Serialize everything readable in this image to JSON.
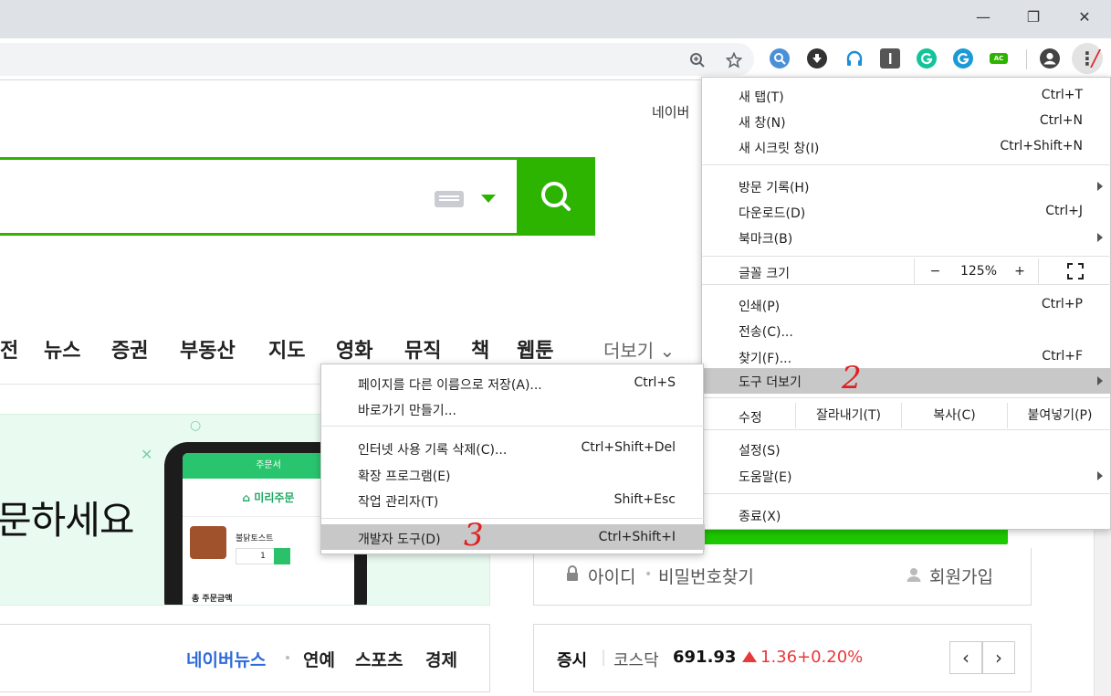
{
  "window": {
    "minimize": "—",
    "maximize": "❐",
    "close": "✕"
  },
  "toolbar": {
    "kebab": "⋮"
  },
  "annotations": {
    "step1": "/",
    "step2": "2",
    "step3": "3"
  },
  "naver": {
    "top_link": "네이버",
    "nav": [
      "전",
      "뉴스",
      "증권",
      "부동산",
      "지도",
      "영화",
      "뮤직",
      "책",
      "웹툰"
    ],
    "nav_more": "더보기 ⌄",
    "banner_text": "문하세요",
    "phone": {
      "header": "주문서",
      "subheader": "⌂ 미리주문",
      "item_name": "불닭토스트",
      "qty": "1",
      "total_label": "총 주문금액"
    },
    "login": {
      "id": "아이디",
      "find_pw": "비밀번호찾기",
      "signup": "회원가입"
    },
    "news": {
      "naver_news": "네이버뉴스",
      "entertainment": "연예",
      "sports": "스포츠",
      "economy": "경제"
    },
    "stock": {
      "label": "증시",
      "index": "코스닥",
      "value": "691.93",
      "change": "1.36",
      "percent": "+0.20%",
      "prev": "‹",
      "next": "›"
    }
  },
  "menu": {
    "new_tab": {
      "label": "새 탭(T)",
      "shortcut": "Ctrl+T"
    },
    "new_window": {
      "label": "새 창(N)",
      "shortcut": "Ctrl+N"
    },
    "incognito": {
      "label": "새 시크릿 창(I)",
      "shortcut": "Ctrl+Shift+N"
    },
    "history": {
      "label": "방문 기록(H)"
    },
    "downloads": {
      "label": "다운로드(D)",
      "shortcut": "Ctrl+J"
    },
    "bookmarks": {
      "label": "북마크(B)"
    },
    "zoom": {
      "label": "글꼴 크기",
      "minus": "−",
      "value": "125%",
      "plus": "+",
      "fullscreen": "⛶"
    },
    "print": {
      "label": "인쇄(P)",
      "shortcut": "Ctrl+P"
    },
    "cast": {
      "label": "전송(C)..."
    },
    "find": {
      "label": "찾기(F)...",
      "shortcut": "Ctrl+F"
    },
    "more_tools": {
      "label": "도구 더보기"
    },
    "edit": {
      "label": "수정",
      "cut": "잘라내기(T)",
      "copy": "복사(C)",
      "paste": "붙여넣기(P)"
    },
    "settings": {
      "label": "설정(S)"
    },
    "help": {
      "label": "도움말(E)"
    },
    "exit": {
      "label": "종료(X)"
    }
  },
  "submenu": {
    "save_as": {
      "label": "페이지를 다른 이름으로 저장(A)...",
      "shortcut": "Ctrl+S"
    },
    "shortcut": {
      "label": "바로가기 만들기..."
    },
    "clear_data": {
      "label": "인터넷 사용 기록 삭제(C)...",
      "shortcut": "Ctrl+Shift+Del"
    },
    "extensions": {
      "label": "확장 프로그램(E)"
    },
    "task_manager": {
      "label": "작업 관리자(T)",
      "shortcut": "Shift+Esc"
    },
    "devtools": {
      "label": "개발자 도구(D)",
      "shortcut": "Ctrl+Shift+I"
    }
  },
  "colors": {
    "naver_green": "#2db400",
    "highlight": "#c8c8c8",
    "annotation_red": "#e02020",
    "stock_up": "#e8393a"
  }
}
